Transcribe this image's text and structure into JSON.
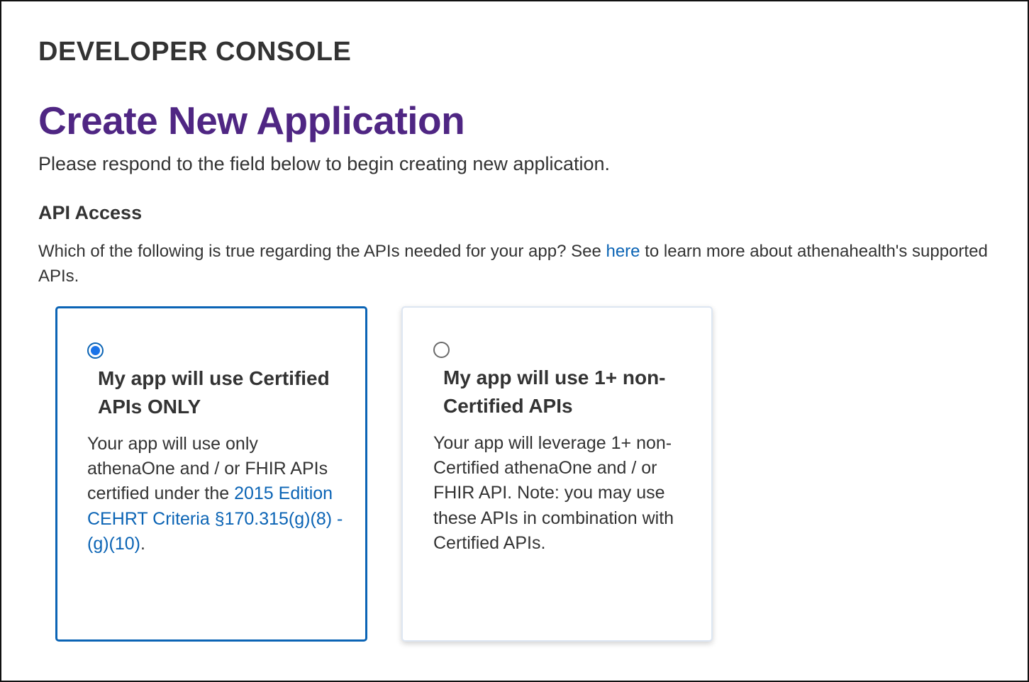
{
  "header": {
    "console_title": "DEVELOPER CONSOLE",
    "page_title": "Create New Application",
    "intro": "Please respond to the field below to begin creating new application."
  },
  "api_access": {
    "section_title": "API Access",
    "question_before": "Which of the following is true regarding the APIs needed for your app? See ",
    "question_link": "here",
    "question_after": " to learn more about athenahealth's supported APIs.",
    "options": [
      {
        "selected": true,
        "title": "My app will use Certified APIs ONLY",
        "body_before": "Your app will use only athenaOne and / or FHIR APIs certified under the ",
        "body_link": "2015 Edition CEHRT Criteria §170.315(g)(8) - (g)(10)",
        "body_after": "."
      },
      {
        "selected": false,
        "title": "My app will use 1+ non-Certified APIs",
        "body": "Your app will leverage 1+ non-Certified athenaOne and / or FHIR API. Note: you may use these APIs in combination with Certified APIs."
      }
    ]
  },
  "colors": {
    "page_title": "#4f2683",
    "link": "#0b64b5",
    "selected_border": "#0b64b5",
    "text": "#333333"
  }
}
